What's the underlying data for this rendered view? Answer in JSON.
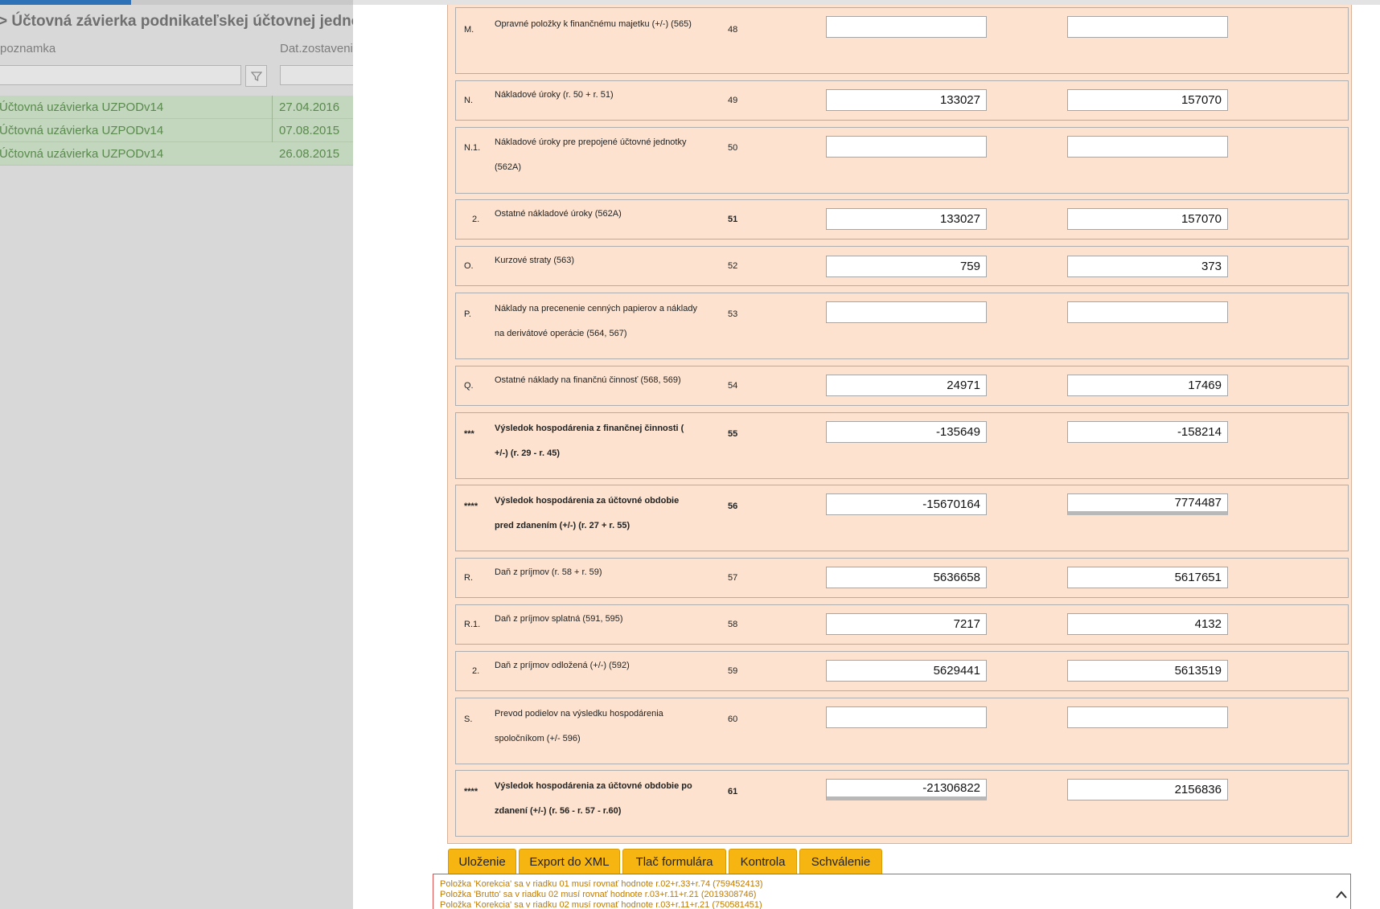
{
  "left": {
    "breadcrumb": "> Účtovná závierka podnikateľskej účtovnej jednotky > U",
    "columns": {
      "note": "poznamka",
      "date": "Dat.zostavenia"
    },
    "rows": [
      {
        "name": "Účtovná uzávierka UZPODv14",
        "date": "27.04.2016"
      },
      {
        "name": "Účtovná uzávierka UZPODv14",
        "date": "07.08.2015"
      },
      {
        "name": "Účtovná uzávierka UZPODv14",
        "date": "26.08.2015"
      }
    ]
  },
  "form": {
    "rows": [
      {
        "code": "M.",
        "label": "Opravné položky k finančnému majetku (+/-) (565)",
        "num": "48",
        "v1": "",
        "v2": ""
      },
      {
        "code": "N.",
        "label": "Nákladové úroky (r. 50 + r. 51)",
        "num": "49",
        "v1": "133027",
        "v2": "157070"
      },
      {
        "code": "N.1.",
        "label": "Nákladové úroky pre prepojené účtovné jednotky (562A)",
        "num": "50",
        "v1": "",
        "v2": ""
      },
      {
        "code": "2.",
        "label": "Ostatné nákladové úroky (562A)",
        "num": "51",
        "v1": "133027",
        "v2": "157070"
      },
      {
        "code": "O.",
        "label": "Kurzové straty (563)",
        "num": "52",
        "v1": "759",
        "v2": "373"
      },
      {
        "code": "P.",
        "label": "Náklady na precenenie cenných papierov a náklady na derivátové operácie (564, 567)",
        "num": "53",
        "v1": "",
        "v2": ""
      },
      {
        "code": "Q.",
        "label": "Ostatné náklady na finančnú činnosť (568, 569)",
        "num": "54",
        "v1": "24971",
        "v2": "17469"
      },
      {
        "code": "***",
        "label": "Výsledok hospodárenia z finančnej činnosti ( +/-) (r. 29 - r. 45)",
        "num": "55",
        "v1": "-135649",
        "v2": "-158214"
      },
      {
        "code": "****",
        "label": "Výsledok hospodárenia za účtovné obdobie pred zdanením (+/-) (r. 27 + r. 55)",
        "num": "56",
        "v1": "-15670164",
        "v2": "7774487"
      },
      {
        "code": "R.",
        "label": "Daň z príjmov (r. 58 + r. 59)",
        "num": "57",
        "v1": "5636658",
        "v2": "5617651"
      },
      {
        "code": "R.1.",
        "label": "Daň z príjmov splatná (591, 595)",
        "num": "58",
        "v1": "7217",
        "v2": "4132"
      },
      {
        "code": "2.",
        "label": "Daň z príjmov odložená (+/-) (592)",
        "num": "59",
        "v1": "5629441",
        "v2": "5613519"
      },
      {
        "code": "S.",
        "label": "Prevod podielov na výsledku hospodárenia spoločníkom (+/- 596)",
        "num": "60",
        "v1": "",
        "v2": ""
      },
      {
        "code": "****",
        "label": "Výsledok hospodárenia za účtovné obdobie po zdanení (+/-) (r. 56 - r. 57 - r.60)",
        "num": "61",
        "v1": "-21306822",
        "v2": "2156836"
      }
    ]
  },
  "buttons": {
    "save": "Uloženie",
    "export": "Export do XML",
    "print": "Tlač formulára",
    "check": "Kontrola",
    "approve": "Schválenie"
  },
  "messages": [
    "Položka 'Korekcia' sa v riadku 01 musí rovnať hodnote r.02+r.33+r.74 (759452413)",
    "Položka 'Brutto' sa v riadku 02 musí rovnať hodnote r.03+r.11+r.21 (2019308746)",
    "Položka 'Korekcia' sa v riadku 02 musí rovnať hodnote r.03+r.11+r.21 (750581451)"
  ]
}
